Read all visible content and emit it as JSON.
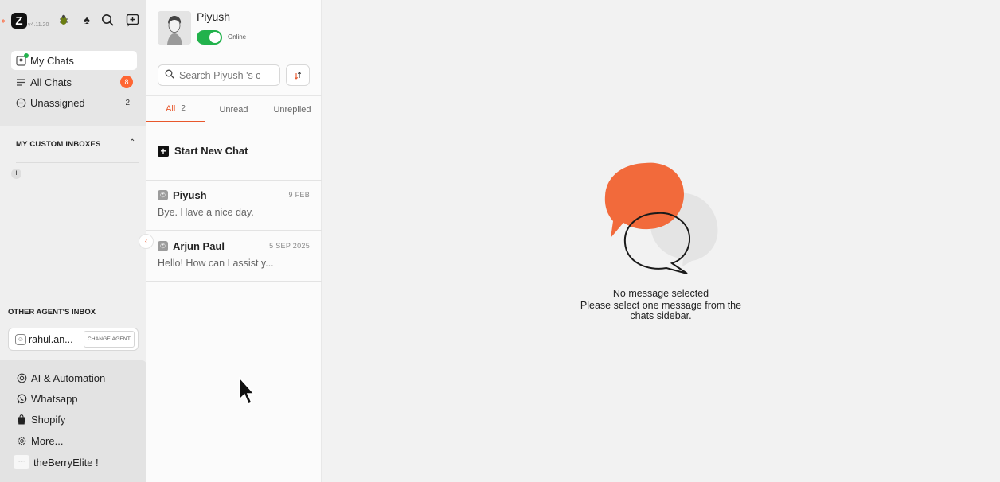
{
  "app": {
    "version": "v4.11.20"
  },
  "nav": {
    "items": [
      {
        "label": "My Chats",
        "icon": "my-chats-icon"
      },
      {
        "label": "All Chats",
        "icon": "list-icon",
        "badge": "8"
      },
      {
        "label": "Unassigned",
        "icon": "unassigned-icon",
        "count": "2"
      }
    ],
    "custom_inboxes_title": "MY CUSTOM INBOXES",
    "other_agents_title": "OTHER AGENT'S INBOX",
    "agent_name": "rahul.an...",
    "change_agent_label": "CHANGE AGENT",
    "bottom_items": [
      {
        "label": "AI & Automation",
        "icon": "ai-icon"
      },
      {
        "label": "Whatsapp",
        "icon": "whatsapp-icon"
      },
      {
        "label": "Shopify",
        "icon": "shopify-icon"
      },
      {
        "label": "More...",
        "icon": "gear-icon"
      }
    ],
    "org_name": "theBerryElite !"
  },
  "profile": {
    "name": "Piyush",
    "status": "Online",
    "online": true
  },
  "search": {
    "placeholder": "Search Piyush 's c"
  },
  "tabs": [
    {
      "label": "All",
      "count": "2",
      "active": true
    },
    {
      "label": "Unread",
      "active": false
    },
    {
      "label": "Unreplied",
      "active": false
    }
  ],
  "new_chat_label": "Start New Chat",
  "chats": [
    {
      "name": "Piyush",
      "date": "9 FEB",
      "message": "Bye. Have a nice day."
    },
    {
      "name": "Arjun Paul",
      "date": "5 SEP 2025",
      "message": "Hello! How can I assist y..."
    }
  ],
  "empty_state": {
    "title": "No message selected",
    "subtitle_line1": "Please select one message from the",
    "subtitle_line2": "chats sidebar."
  },
  "colors": {
    "accent": "#e8572c",
    "online_green": "#22b24c",
    "badge_orange": "#ff6633"
  }
}
